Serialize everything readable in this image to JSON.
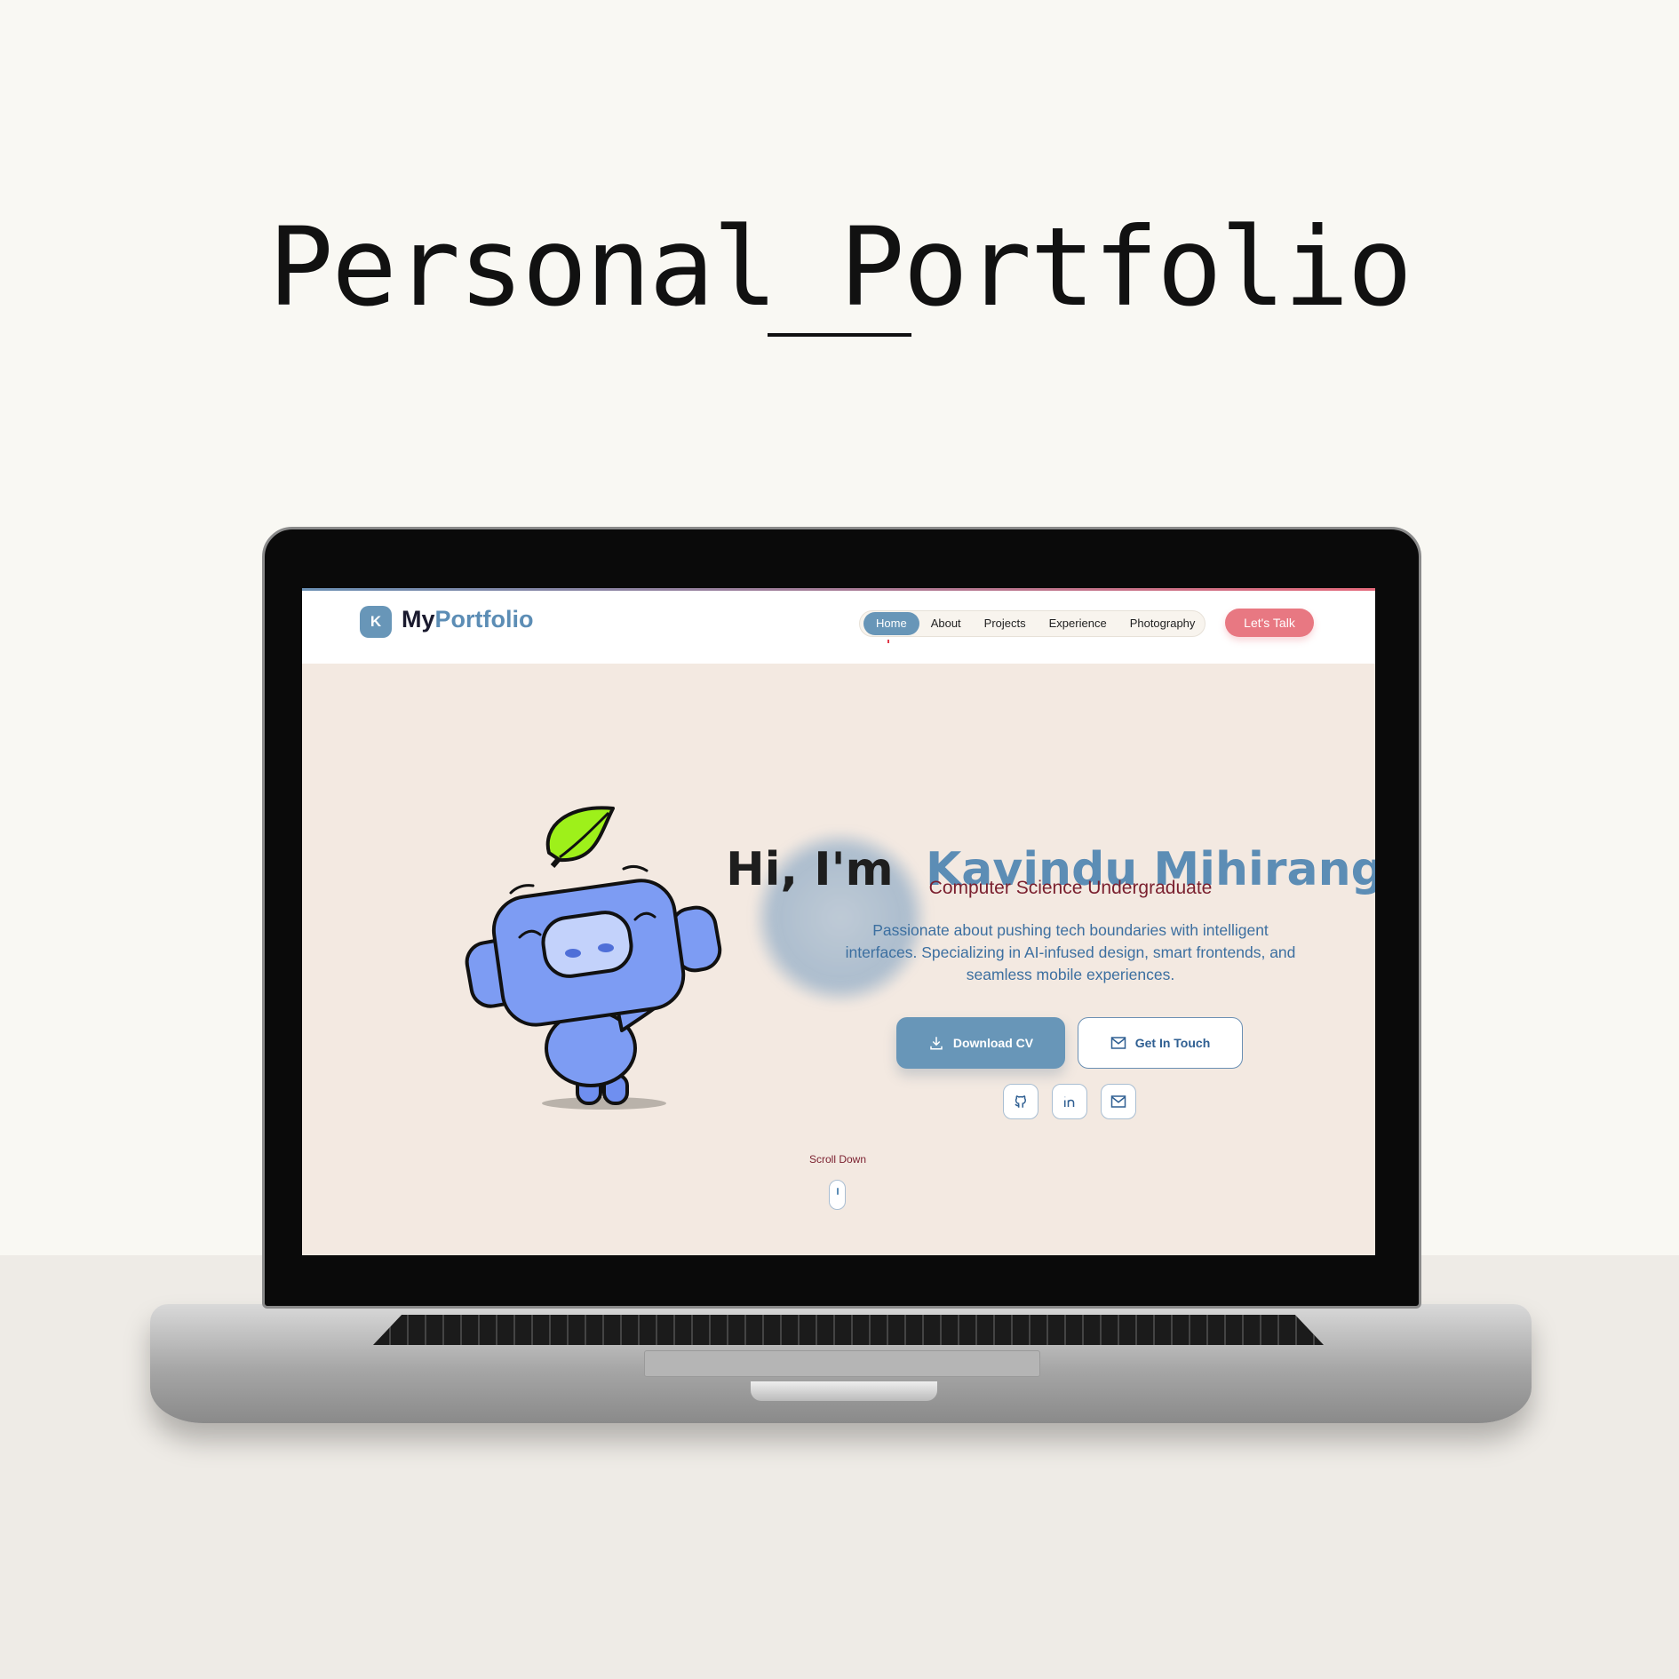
{
  "headline": "Personal Portfolio",
  "site": {
    "logo_letter": "K",
    "logo_my": "My",
    "logo_portfolio": "Portfolio",
    "nav": [
      {
        "label": "Home",
        "active": true
      },
      {
        "label": "About"
      },
      {
        "label": "Projects"
      },
      {
        "label": "Experience"
      },
      {
        "label": "Photography"
      }
    ],
    "cta": "Let's Talk",
    "hero": {
      "greeting": "Hi, I'm",
      "name": "Kavindu Mihiranga",
      "subtitle": "Computer Science Undergraduate",
      "description": "Passionate about pushing tech boundaries with intelligent interfaces. Specializing in AI-infused design, smart frontends, and seamless mobile experiences.",
      "download_cv": "Download CV",
      "get_in_touch": "Get In Touch",
      "socials": [
        "github-icon",
        "linkedin-icon",
        "mail-icon"
      ],
      "scroll_label": "Scroll Down"
    }
  },
  "colors": {
    "accent": "#6896b8",
    "cta": "#e87882",
    "subtitle": "#7a1f2e",
    "body_text": "#3c6fa0",
    "hero_bg": "#f3e9e1"
  }
}
